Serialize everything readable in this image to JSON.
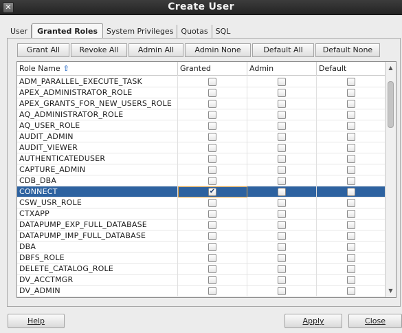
{
  "window": {
    "title": "Create User",
    "close_glyph": "✕"
  },
  "tabs": [
    {
      "label": "User",
      "active": false
    },
    {
      "label": "Granted Roles",
      "active": true
    },
    {
      "label": "System Privileges",
      "active": false
    },
    {
      "label": "Quotas",
      "active": false
    },
    {
      "label": "SQL",
      "active": false
    }
  ],
  "toolbar": {
    "grant_all": "Grant All",
    "revoke_all": "Revoke All",
    "admin_all": "Admin All",
    "admin_none": "Admin None",
    "default_all": "Default All",
    "default_none": "Default None"
  },
  "table": {
    "columns": {
      "role_name": "Role Name",
      "granted": "Granted",
      "admin": "Admin",
      "default": "Default"
    },
    "sort_icon": "sort-ascending-icon",
    "rows": [
      {
        "name": "ADM_PARALLEL_EXECUTE_TASK",
        "granted": false,
        "admin": false,
        "default": false
      },
      {
        "name": "APEX_ADMINISTRATOR_ROLE",
        "granted": false,
        "admin": false,
        "default": false
      },
      {
        "name": "APEX_GRANTS_FOR_NEW_USERS_ROLE",
        "granted": false,
        "admin": false,
        "default": false
      },
      {
        "name": "AQ_ADMINISTRATOR_ROLE",
        "granted": false,
        "admin": false,
        "default": false
      },
      {
        "name": "AQ_USER_ROLE",
        "granted": false,
        "admin": false,
        "default": false
      },
      {
        "name": "AUDIT_ADMIN",
        "granted": false,
        "admin": false,
        "default": false
      },
      {
        "name": "AUDIT_VIEWER",
        "granted": false,
        "admin": false,
        "default": false
      },
      {
        "name": "AUTHENTICATEDUSER",
        "granted": false,
        "admin": false,
        "default": false
      },
      {
        "name": "CAPTURE_ADMIN",
        "granted": false,
        "admin": false,
        "default": false
      },
      {
        "name": "CDB_DBA",
        "granted": false,
        "admin": false,
        "default": false
      },
      {
        "name": "CONNECT",
        "granted": true,
        "admin": false,
        "default": false,
        "selected": true
      },
      {
        "name": "CSW_USR_ROLE",
        "granted": false,
        "admin": false,
        "default": false
      },
      {
        "name": "CTXAPP",
        "granted": false,
        "admin": false,
        "default": false
      },
      {
        "name": "DATAPUMP_EXP_FULL_DATABASE",
        "granted": false,
        "admin": false,
        "default": false
      },
      {
        "name": "DATAPUMP_IMP_FULL_DATABASE",
        "granted": false,
        "admin": false,
        "default": false
      },
      {
        "name": "DBA",
        "granted": false,
        "admin": false,
        "default": false
      },
      {
        "name": "DBFS_ROLE",
        "granted": false,
        "admin": false,
        "default": false
      },
      {
        "name": "DELETE_CATALOG_ROLE",
        "granted": false,
        "admin": false,
        "default": false
      },
      {
        "name": "DV_ACCTMGR",
        "granted": false,
        "admin": false,
        "default": false
      },
      {
        "name": "DV_ADMIN",
        "granted": false,
        "admin": false,
        "default": false
      }
    ]
  },
  "buttons": {
    "help": "Help",
    "apply": "Apply",
    "close": "Close"
  },
  "colors": {
    "selection": "#2d62a0",
    "focus_outline": "#e4a23c",
    "sort_arrow": "#3573c8"
  }
}
